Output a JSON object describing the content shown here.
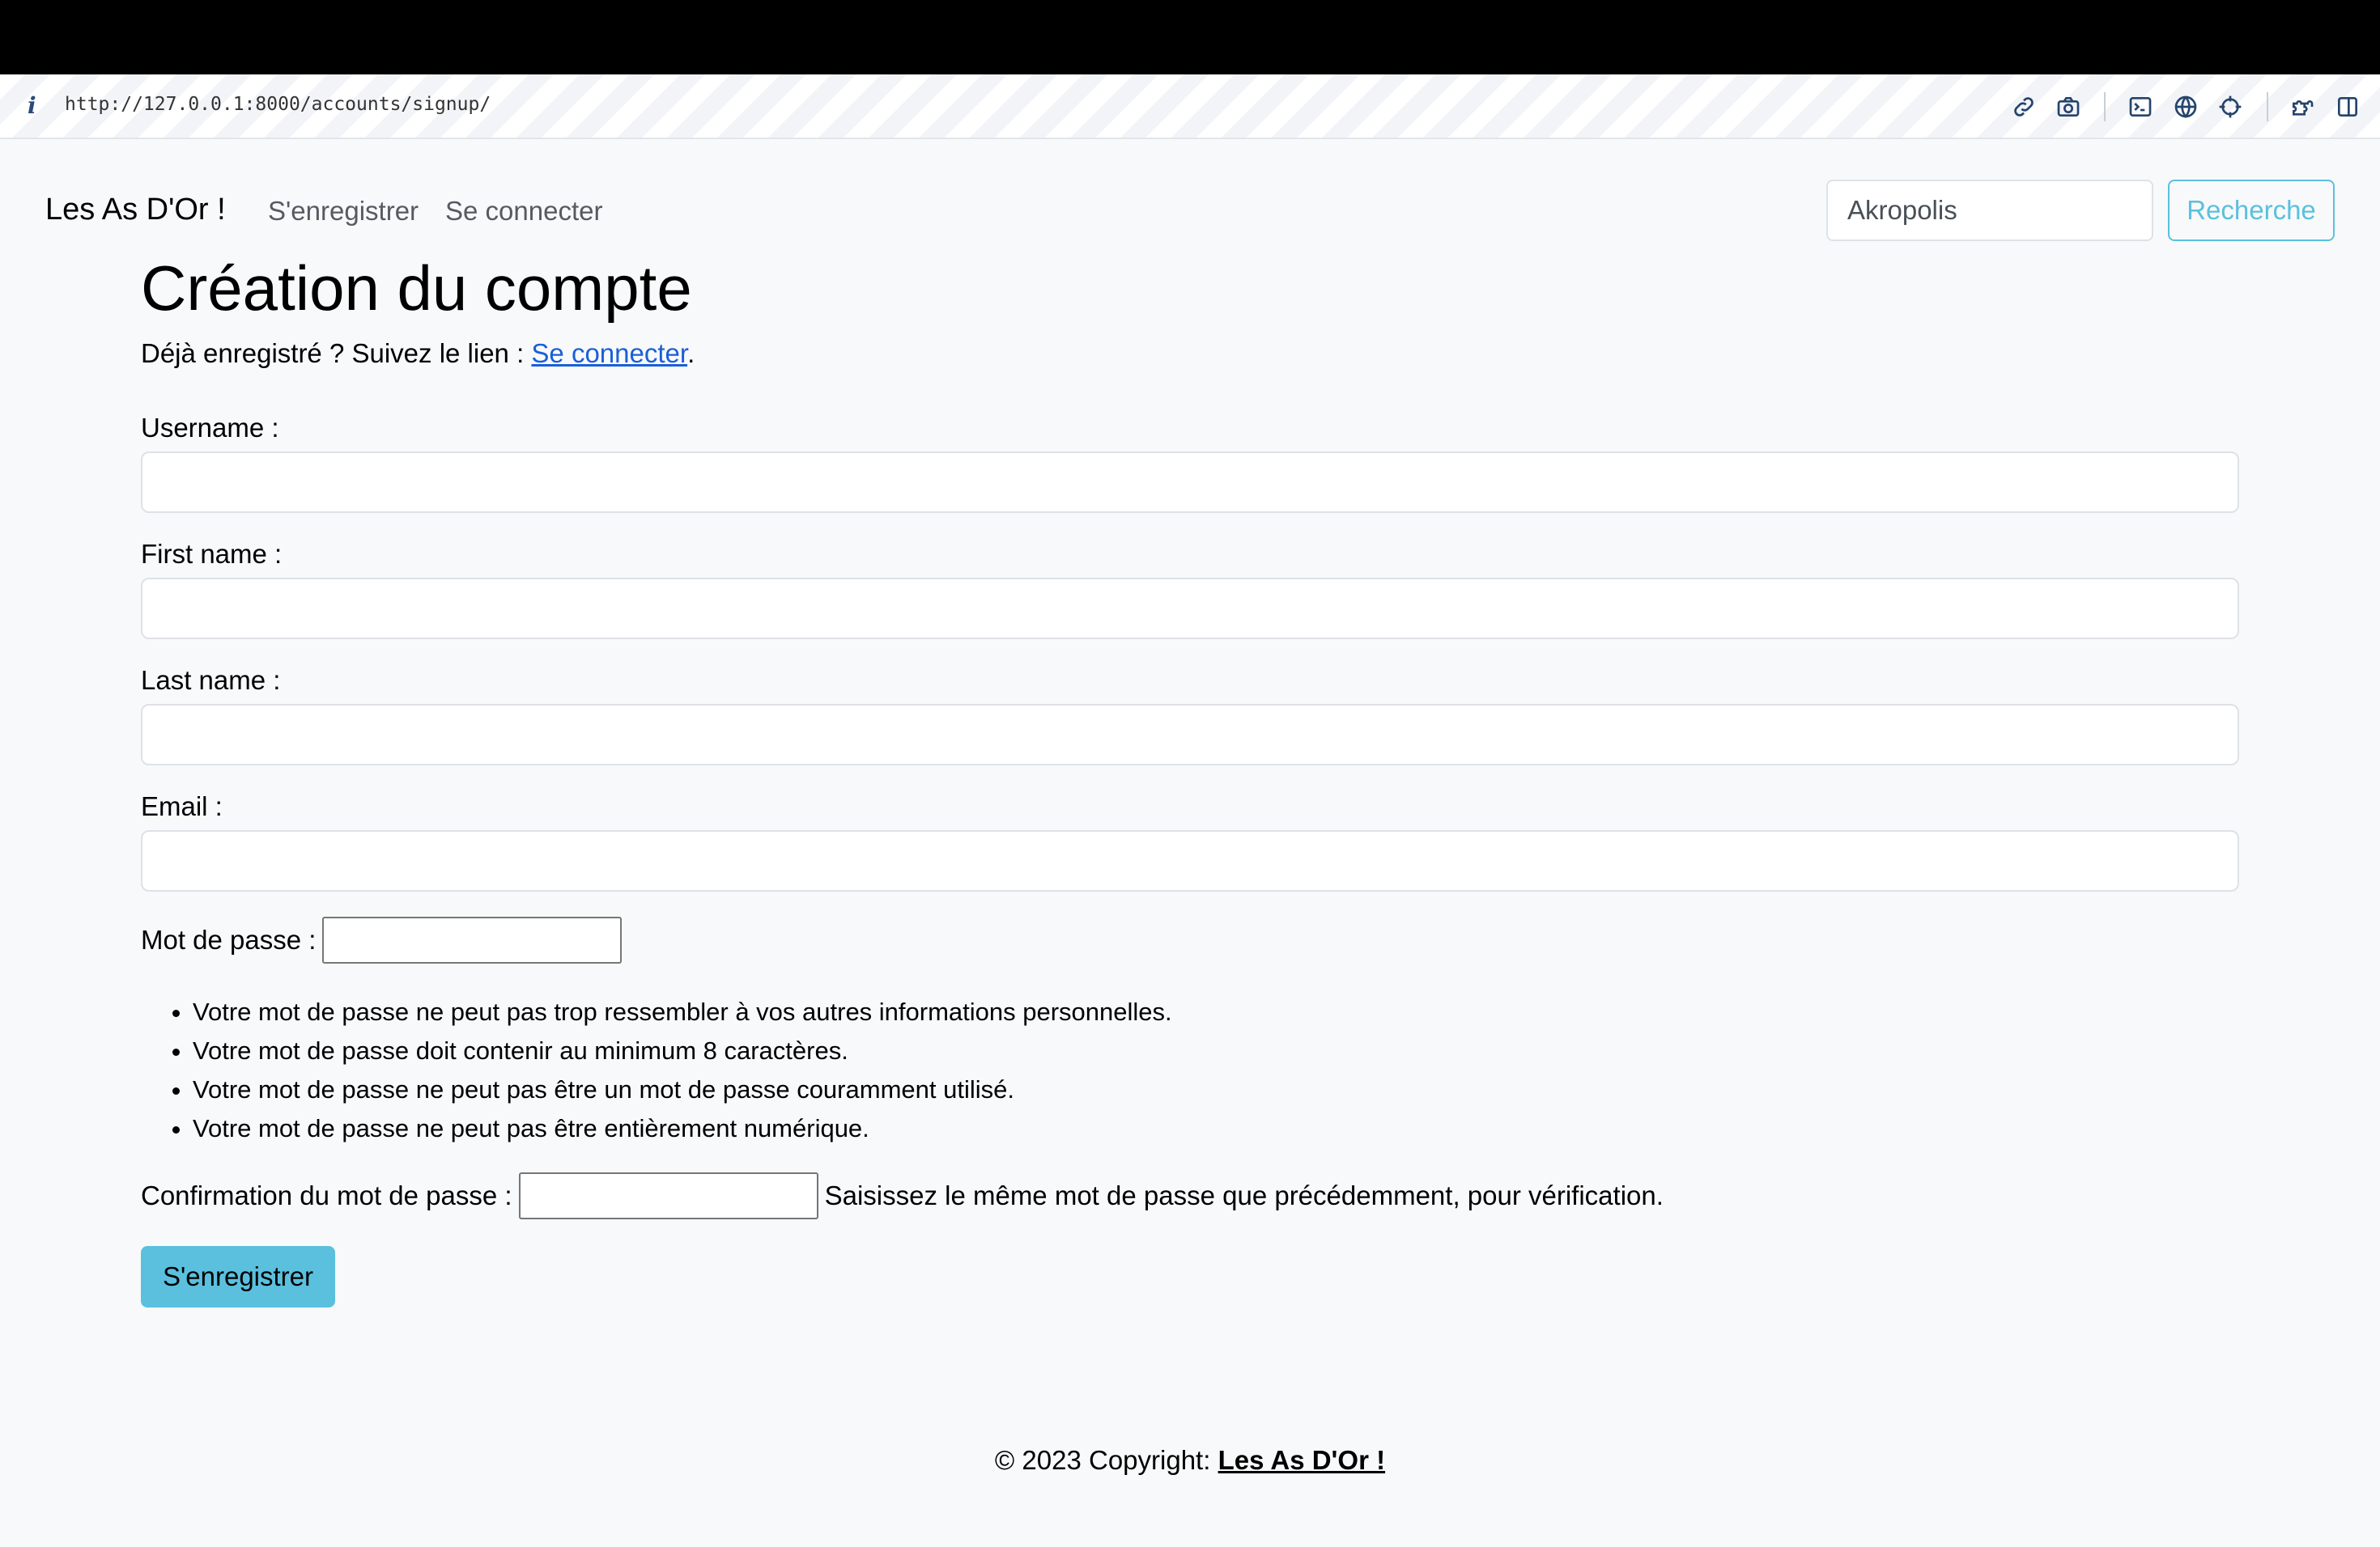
{
  "browser": {
    "info_glyph": "i",
    "url": "http://127.0.0.1:8000/accounts/signup/",
    "toolbar_icons": [
      "link-icon",
      "camera-icon",
      "terminal-icon",
      "globe-icon",
      "crosshair-icon",
      "extensions-icon",
      "sidebar-icon"
    ]
  },
  "navbar": {
    "brand": "Les As D'Or !",
    "links": [
      "S'enregistrer",
      "Se connecter"
    ],
    "search_value": "Akropolis",
    "search_button": "Recherche"
  },
  "page": {
    "title": "Création du compte",
    "intro_text": "Déjà enregistré ? Suivez le lien : ",
    "intro_link": "Se connecter",
    "intro_end": "."
  },
  "form": {
    "username_label": "Username :",
    "first_name_label": "First name :",
    "last_name_label": "Last name :",
    "email_label": "Email :",
    "password_label": "Mot de passe :",
    "password_rules": [
      "Votre mot de passe ne peut pas trop ressembler à vos autres informations personnelles.",
      "Votre mot de passe doit contenir au minimum 8 caractères.",
      "Votre mot de passe ne peut pas être un mot de passe couramment utilisé.",
      "Votre mot de passe ne peut pas être entièrement numérique."
    ],
    "confirm_label": "Confirmation du mot de passe :",
    "confirm_help": "Saisissez le même mot de passe que précédemment, pour vérification.",
    "submit": "S'enregistrer"
  },
  "footer": {
    "text": "© 2023 Copyright: ",
    "link": "Les As D'Or !"
  },
  "colors": {
    "accent": "#5bc0de",
    "link": "#1a5fd8",
    "background": "#f8f9fa"
  }
}
